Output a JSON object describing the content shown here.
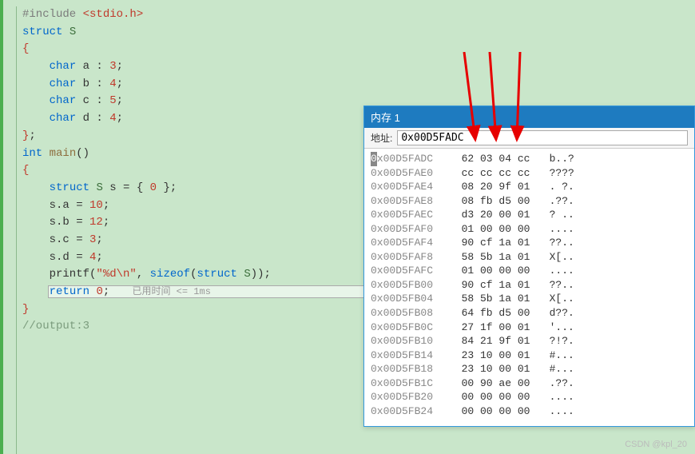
{
  "code": {
    "l0": "#include",
    "l0h": " <stdio.h>",
    "l1": "struct S",
    "l3a": "    char a : 3;",
    "l3b": "    char b : 4;",
    "l3c": "    char c : 5;",
    "l3d": "    char d : 4;",
    "l4": "int main()",
    "l5": "    struct S s = { 0 };",
    "l6a": "    s.a = 10;",
    "l6b": "    s.b = 12;",
    "l6c": "    s.c = 3;",
    "l6d": "    s.d = 4;",
    "printf_fmt": "\"%d\\n\"",
    "printf_arg": "sizeof(struct S)",
    "printf_prefix": "    printf(",
    "printf_sep": ", ",
    "printf_close": ");",
    "return_kw": "return",
    "return_val": "0",
    "return_semi": ";",
    "hint_prefix": "已用时间",
    "hint_suffix": " <= 1ms",
    "output_cmt": "//output:3"
  },
  "memwin": {
    "title": "内存 1",
    "addr_label": "地址:",
    "addr_value": "0x00D5FADC",
    "rows": [
      {
        "addr": "0x00D5FADC",
        "hex": "62 03 04 cc",
        "ascii": "b..?"
      },
      {
        "addr": "0x00D5FAE0",
        "hex": "cc cc cc cc",
        "ascii": "????"
      },
      {
        "addr": "0x00D5FAE4",
        "hex": "08 20 9f 01",
        "ascii": ". ?."
      },
      {
        "addr": "0x00D5FAE8",
        "hex": "08 fb d5 00",
        "ascii": ".??."
      },
      {
        "addr": "0x00D5FAEC",
        "hex": "d3 20 00 01",
        "ascii": "? .."
      },
      {
        "addr": "0x00D5FAF0",
        "hex": "01 00 00 00",
        "ascii": "...."
      },
      {
        "addr": "0x00D5FAF4",
        "hex": "90 cf 1a 01",
        "ascii": "??.."
      },
      {
        "addr": "0x00D5FAF8",
        "hex": "58 5b 1a 01",
        "ascii": "X[.."
      },
      {
        "addr": "0x00D5FAFC",
        "hex": "01 00 00 00",
        "ascii": "...."
      },
      {
        "addr": "0x00D5FB00",
        "hex": "90 cf 1a 01",
        "ascii": "??.."
      },
      {
        "addr": "0x00D5FB04",
        "hex": "58 5b 1a 01",
        "ascii": "X[.."
      },
      {
        "addr": "0x00D5FB08",
        "hex": "64 fb d5 00",
        "ascii": "d??."
      },
      {
        "addr": "0x00D5FB0C",
        "hex": "27 1f 00 01",
        "ascii": "'..."
      },
      {
        "addr": "0x00D5FB10",
        "hex": "84 21 9f 01",
        "ascii": "?!?."
      },
      {
        "addr": "0x00D5FB14",
        "hex": "23 10 00 01",
        "ascii": "#..."
      },
      {
        "addr": "0x00D5FB18",
        "hex": "23 10 00 01",
        "ascii": "#..."
      },
      {
        "addr": "0x00D5FB1C",
        "hex": "00 90 ae 00",
        "ascii": ".??."
      },
      {
        "addr": "0x00D5FB20",
        "hex": "00 00 00 00",
        "ascii": "...."
      },
      {
        "addr": "0x00D5FB24",
        "hex": "00 00 00 00",
        "ascii": "...."
      }
    ]
  },
  "watermark": "CSDN @kpl_20"
}
